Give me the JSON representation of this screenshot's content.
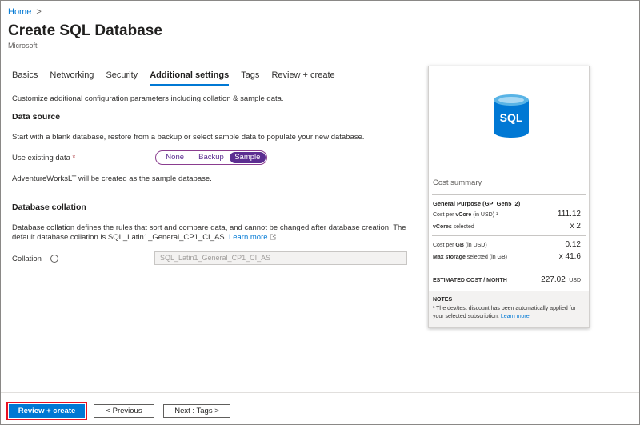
{
  "breadcrumb": {
    "home": "Home",
    "chevron": ">"
  },
  "header": {
    "title": "Create SQL Database",
    "more": "···",
    "subtitle": "Microsoft"
  },
  "tabs": [
    {
      "label": "Basics"
    },
    {
      "label": "Networking"
    },
    {
      "label": "Security"
    },
    {
      "label": "Additional settings",
      "active": true
    },
    {
      "label": "Tags"
    },
    {
      "label": "Review + create"
    }
  ],
  "intro": "Customize additional configuration parameters including collation & sample data.",
  "data_source": {
    "heading": "Data source",
    "description": "Start with a blank database, restore from a backup or select sample data to populate your new database.",
    "field_label": "Use existing data",
    "required_mark": "*",
    "options": [
      "None",
      "Backup",
      "Sample"
    ],
    "selected": "Sample",
    "note": "AdventureWorksLT will be created as the sample database."
  },
  "collation": {
    "heading": "Database collation",
    "description_1": "Database collation defines the rules that sort and compare data, and cannot be changed after database creation. The",
    "description_2": "default database collation is SQL_Latin1_General_CP1_CI_AS.",
    "learn_more": "Learn more",
    "field_label": "Collation",
    "value": "SQL_Latin1_General_CP1_CI_AS"
  },
  "cost_card": {
    "logo_text": "SQL",
    "summary_title": "Cost summary",
    "tier": "General Purpose (GP_Gen5_2)",
    "rows": [
      {
        "label_pre": "Cost per ",
        "label_bold": "vCore",
        "label_post": " (in USD) ¹",
        "value": "111.12"
      },
      {
        "label_pre": "",
        "label_bold": "vCores",
        "label_post": " selected",
        "value": "x 2"
      },
      {
        "label_pre": "Cost per ",
        "label_bold": "GB",
        "label_post": " (in USD)",
        "value": "0.12"
      },
      {
        "label_pre": "",
        "label_bold": "Max storage",
        "label_post": " selected (in GB)",
        "value": "x 41.6"
      }
    ],
    "estimated_label": "ESTIMATED COST / MONTH",
    "estimated_value": "227.02",
    "currency": "USD",
    "notes_heading": "NOTES",
    "notes_text": "¹ The dev/test discount has been automatically applied for your selected subscription.",
    "notes_link": "Learn more"
  },
  "footer": {
    "review_create": "Review + create",
    "previous": "< Previous",
    "next": "Next : Tags >"
  },
  "colors": {
    "accent": "#0078d4",
    "segment": "#5c2e91",
    "sql_logo": "#0078d4"
  }
}
